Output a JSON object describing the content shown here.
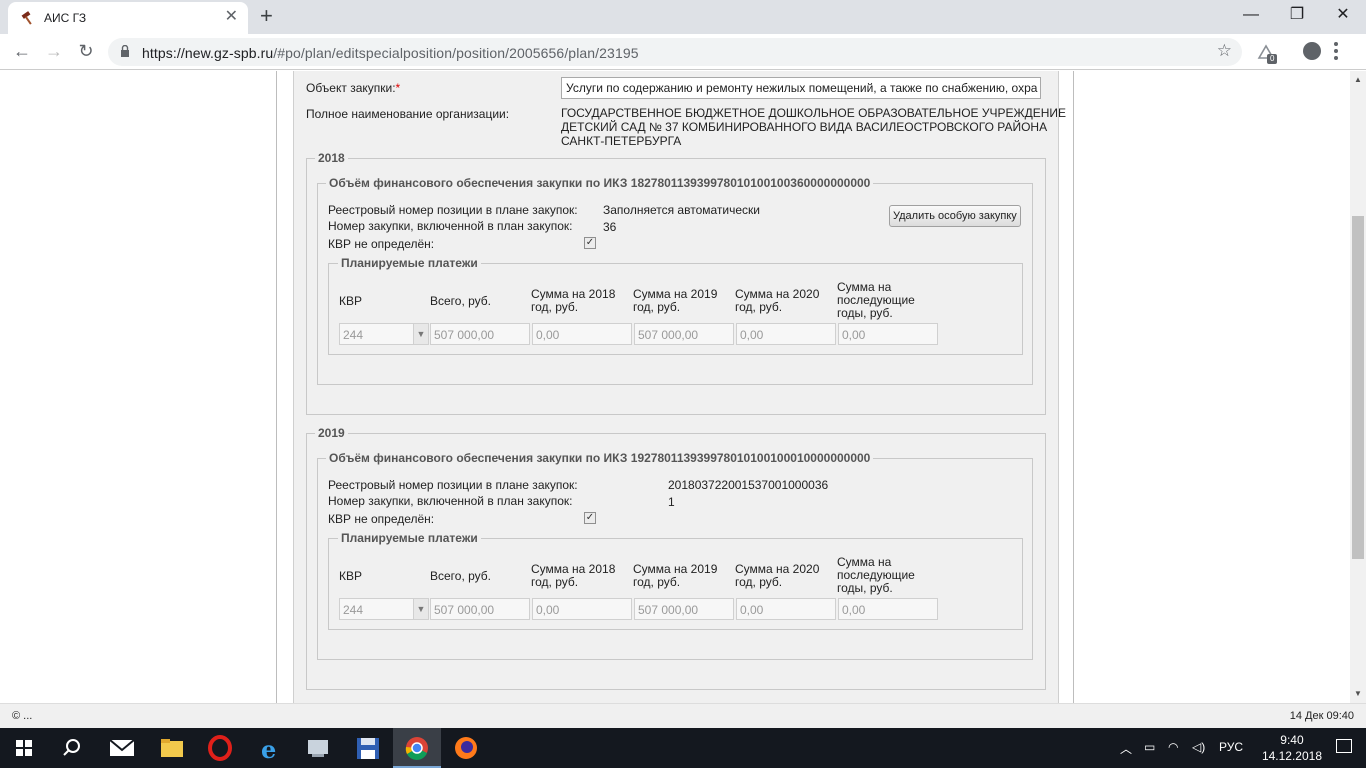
{
  "browser": {
    "tab_title": "АИС ГЗ",
    "new_tab_symbol": "+",
    "close_symbol": "✕",
    "url_host": "https://new.gz-spb.ru",
    "url_path": "/#po/plan/editspecialposition/position/2005656/plan/23195",
    "extension_badge": "0"
  },
  "form": {
    "object_label": "Объект закупки:",
    "required_mark": "*",
    "object_value": "Услуги по содержанию и ремонту нежилых помещений, а также по снабжению, охра",
    "org_label": "Полное наименование организации:",
    "org_name_line1": "ГОСУДАРСТВЕННОЕ БЮДЖЕТНОЕ ДОШКОЛЬНОЕ ОБРАЗОВАТЕЛЬНОЕ УЧРЕЖДЕНИЕ",
    "org_name_line2": "ДЕТСКИЙ САД № 37 КОМБИНИРОВАННОГО ВИДА ВАСИЛЕОСТРОВСКОГО РАЙОНА",
    "org_name_line3": "САНКТ-ПЕТЕРБУРГА"
  },
  "years": [
    {
      "year": "2018",
      "financing_legend": "Объём финансового обеспечения закупки по ИКЗ 182780113939978010100100360000000000",
      "registry_label": "Реестровый номер позиции в плане закупок:",
      "registry_value": "Заполняется автоматически",
      "purchase_no_label": "Номер закупки, включенной в план закупок:",
      "purchase_no_value": "36",
      "kvr_label": "КВР не определён:",
      "kvr_checked": "✓",
      "delete_button": "Удалить особую закупку",
      "payments_legend": "Планируемые платежи",
      "headers": {
        "kvr": "КВР",
        "total": "Всего, руб.",
        "y2018_l1": "Сумма на 2018",
        "y2018_l2": "год, руб.",
        "y2019_l1": "Сумма на 2019",
        "y2019_l2": "год, руб.",
        "y2020_l1": "Сумма на 2020",
        "y2020_l2": "год, руб.",
        "later_l1": "Сумма на",
        "later_l2": "последующие",
        "later_l3": "годы, руб."
      },
      "row": {
        "kvr": "244",
        "total": "507 000,00",
        "y2018": "0,00",
        "y2019": "507 000,00",
        "y2020": "0,00",
        "later": "0,00"
      }
    },
    {
      "year": "2019",
      "financing_legend": "Объём финансового обеспечения закупки по ИКЗ 192780113939978010100100010000000000",
      "registry_label": "Реестровый номер позиции в плане закупок:",
      "registry_value": "201803722001537001000036",
      "purchase_no_label": "Номер закупки, включенной в план закупок:",
      "purchase_no_value": "1",
      "kvr_label": "КВР не определён:",
      "kvr_checked": "✓",
      "payments_legend": "Планируемые платежи",
      "headers": {
        "kvr": "КВР",
        "total": "Всего, руб.",
        "y2018_l1": "Сумма на 2018",
        "y2018_l2": "год, руб.",
        "y2019_l1": "Сумма на 2019",
        "y2019_l2": "год, руб.",
        "y2020_l1": "Сумма на 2020",
        "y2020_l2": "год, руб.",
        "later_l1": "Сумма на",
        "later_l2": "последующие",
        "later_l3": "годы, руб."
      },
      "row": {
        "kvr": "244",
        "total": "507 000,00",
        "y2018": "0,00",
        "y2019": "507 000,00",
        "y2020": "0,00",
        "later": "0,00"
      }
    }
  ],
  "statusbar": {
    "left": "© ...",
    "right": "14 Дек 09:40"
  },
  "taskbar": {
    "lang": "РУС",
    "time": "9:40",
    "date": "14.12.2018"
  }
}
